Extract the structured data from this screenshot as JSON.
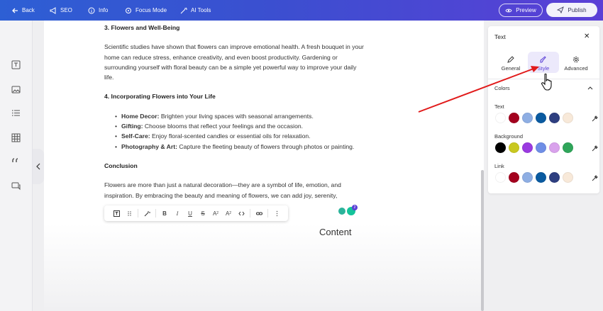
{
  "topbar": {
    "back_label": "Back",
    "seo_label": "SEO",
    "info_label": "Info",
    "focus_label": "Focus Mode",
    "ai_label": "AI Tools",
    "preview_label": "Preview",
    "publish_label": "Publish"
  },
  "document": {
    "heading3": "3. Flowers and Well-Being",
    "para3": "Scientific studies have shown that flowers can improve emotional health. A fresh bouquet in your home can reduce stress, enhance creativity, and even boost productivity. Gardening or surrounding yourself with floral beauty can be a simple yet powerful way to improve your daily life.",
    "heading4": "4. Incorporating Flowers into Your Life",
    "bullets": [
      {
        "term": "Home Decor:",
        "text": " Brighten your living spaces with seasonal arrangements."
      },
      {
        "term": "Gifting:",
        "text": " Choose blooms that reflect your feelings and the occasion."
      },
      {
        "term": "Self-Care:",
        "text": " Enjoy floral-scented candles or essential oils for relaxation."
      },
      {
        "term": "Photography & Art:",
        "text": " Capture the fleeting beauty of flowers through photos or painting."
      }
    ],
    "conclusion_heading": "Conclusion",
    "conclusion_text": "Flowers are more than just a natural decoration—they are a symbol of life, emotion, and inspiration. By embracing the beauty and meaning of flowers, we can add joy, serenity,",
    "content_label": "Content",
    "grammarly_badge": "2"
  },
  "panel": {
    "title": "Text",
    "tabs": [
      {
        "label": "General"
      },
      {
        "label": "Style"
      },
      {
        "label": "Advanced"
      }
    ],
    "section_title": "Colors",
    "rows": [
      {
        "label": "Text",
        "colors": [
          "#ffffff",
          "#a3001e",
          "#8eaee3",
          "#0a5aa0",
          "#2e3f80",
          "#f8e9d9"
        ]
      },
      {
        "label": "Background",
        "colors": [
          "#000000",
          "#c9c820",
          "#9a3ae0",
          "#6f8ee6",
          "#d9a2ec",
          "#2fa55a"
        ]
      },
      {
        "label": "Link",
        "colors": [
          "#ffffff",
          "#a3001e",
          "#8eaee3",
          "#0a5aa0",
          "#2e3f80",
          "#f8e9d9"
        ]
      }
    ]
  },
  "colors": {
    "accent": "#5a3fd6",
    "annotation_arrow": "#e11a1a"
  }
}
